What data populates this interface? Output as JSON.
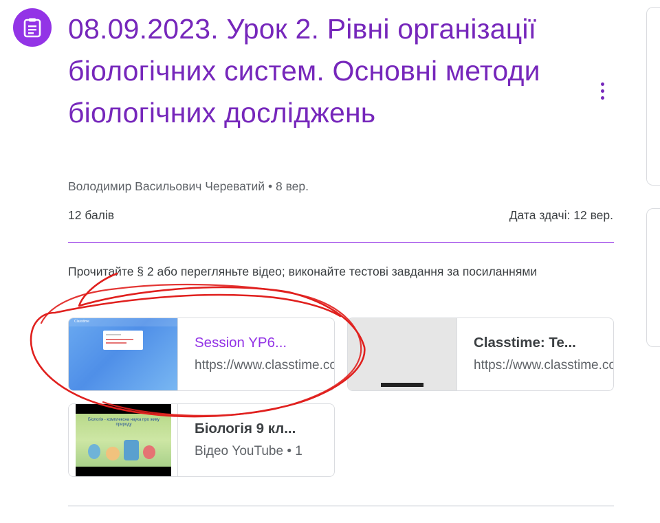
{
  "assignment": {
    "icon": "assignment-icon",
    "title": "08.09.2023. Урок 2. Рівні організації біологічних систем. Основні методи біологічних досліджень",
    "author": "Володимир Васильович Череватий",
    "date": "8 вер.",
    "points": "12 балів",
    "due": "Дата здачі: 12 вер.",
    "instructions": "Прочитайте § 2 або перегляньте відео; виконайте тестові завдання за посиланнями"
  },
  "attachments": [
    {
      "title": "Session YP6...",
      "subtitle": "https://www.classtime.com"
    },
    {
      "title": "Classtime: Te...",
      "subtitle": "https://www.classtime.com"
    },
    {
      "title": "Біологія 9 кл...",
      "subtitle": "Відео YouTube • 1"
    }
  ],
  "thumbnails": {
    "classtime_brand": "Classtime",
    "video_caption": "Біологія - комплексна наука про живу природу"
  },
  "colors": {
    "accent": "#9334e6",
    "title": "#7627bb",
    "annotation": "#e0201e"
  }
}
